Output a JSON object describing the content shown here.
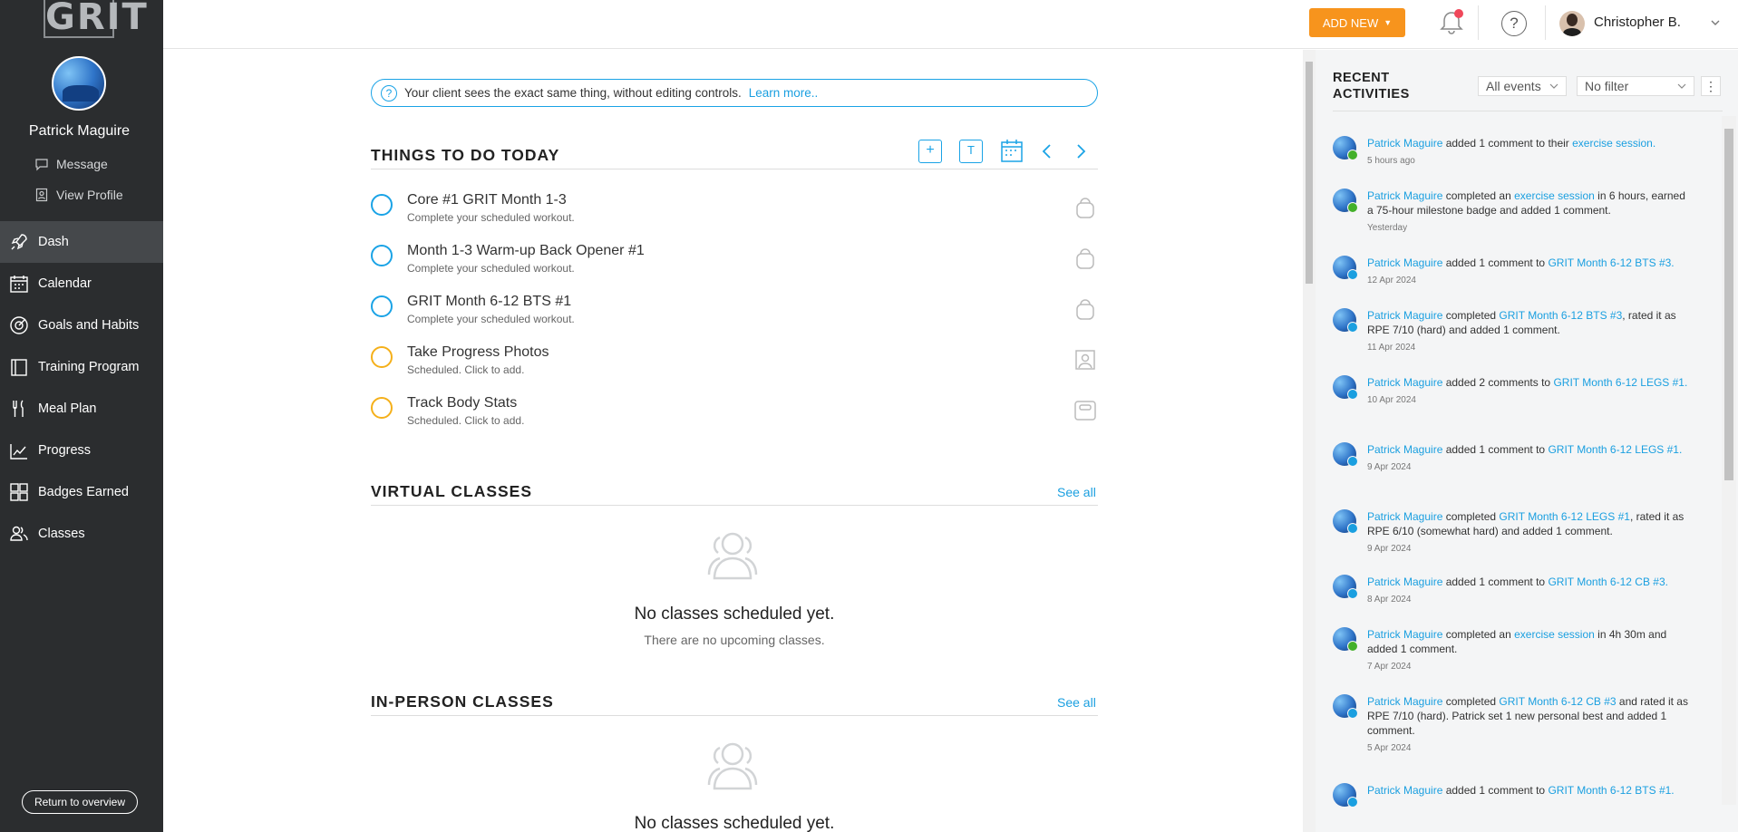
{
  "app": {
    "logo_text": "GRIT"
  },
  "sidebar": {
    "profile_name": "Patrick Maguire",
    "message_label": "Message",
    "view_profile_label": "View Profile",
    "items": [
      {
        "label": "Dash",
        "icon": "rocket-icon",
        "active": true
      },
      {
        "label": "Calendar",
        "icon": "calendar-icon"
      },
      {
        "label": "Goals and Habits",
        "icon": "goals-icon"
      },
      {
        "label": "Training Program",
        "icon": "training-program-icon"
      },
      {
        "label": "Meal Plan",
        "icon": "fork-knife-icon"
      },
      {
        "label": "Progress",
        "icon": "progress-chart-icon"
      },
      {
        "label": "Badges Earned",
        "icon": "badges-grid-icon"
      },
      {
        "label": "Classes",
        "icon": "classes-icon"
      }
    ],
    "return_label": "Return to overview"
  },
  "topbar": {
    "add_new_label": "ADD NEW",
    "user_name": "Christopher B.",
    "notification_dot_color": "#f0475a",
    "help_symbol": "?"
  },
  "banner": {
    "text": "Your client sees the exact same thing, without editing controls.",
    "link": "Learn more.."
  },
  "todo": {
    "title": "THINGS TO DO TODAY",
    "tasks": [
      {
        "title": "Core #1 GRIT Month 1-3",
        "sub": "Complete your scheduled workout.",
        "status": "blue",
        "icon": "kettlebell-icon"
      },
      {
        "title": "Month 1-3 Warm-up Back Opener #1",
        "sub": "Complete your scheduled workout.",
        "status": "blue",
        "icon": "kettlebell-icon"
      },
      {
        "title": "GRIT Month 6-12 BTS #1",
        "sub": "Complete your scheduled workout.",
        "status": "blue",
        "icon": "kettlebell-icon"
      },
      {
        "title": "Take Progress Photos",
        "sub": "Scheduled. Click to add.",
        "status": "orange",
        "icon": "photo-icon"
      },
      {
        "title": "Track Body Stats",
        "sub": "Scheduled. Click to add.",
        "status": "orange",
        "icon": "scale-icon"
      }
    ]
  },
  "virtual_classes": {
    "title": "VIRTUAL CLASSES",
    "see_all": "See all",
    "empty_title": "No classes scheduled yet.",
    "empty_sub": "There are no upcoming classes."
  },
  "inperson_classes": {
    "title": "IN-PERSON CLASSES",
    "see_all": "See all",
    "empty_title": "No classes scheduled yet."
  },
  "recent": {
    "title_line1": "RECENT",
    "title_line2": "ACTIVITIES",
    "filter_events": "All events",
    "filter_other": "No filter",
    "activities": [
      {
        "parts": [
          [
            "link",
            "Patrick Maguire"
          ],
          [
            "text",
            " added 1 comment to their "
          ],
          [
            "link",
            "exercise session."
          ]
        ],
        "date": "5 hours ago",
        "badge": "#43b02a"
      },
      {
        "parts": [
          [
            "link",
            "Patrick Maguire"
          ],
          [
            "text",
            " completed an "
          ],
          [
            "link",
            "exercise session"
          ],
          [
            "text",
            " in 6 hours, earned a 75-hour milestone badge and added 1 comment."
          ]
        ],
        "date": "Yesterday",
        "badge": "#43b02a"
      },
      {
        "parts": [
          [
            "link",
            "Patrick Maguire"
          ],
          [
            "text",
            " added 1 comment to "
          ],
          [
            "link",
            "GRIT Month 6-12 BTS #3."
          ]
        ],
        "date": "12 Apr 2024",
        "badge": "#1a9fe0"
      },
      {
        "parts": [
          [
            "link",
            "Patrick Maguire"
          ],
          [
            "text",
            " completed "
          ],
          [
            "link",
            "GRIT Month 6-12 BTS #3"
          ],
          [
            "text",
            ", rated it as RPE 7/10 (hard) and added 1 comment."
          ]
        ],
        "date": "11 Apr 2024",
        "badge": "#1a9fe0"
      },
      {
        "parts": [
          [
            "link",
            "Patrick Maguire"
          ],
          [
            "text",
            " added 2 comments to "
          ],
          [
            "link",
            "GRIT Month 6-12 LEGS #1."
          ]
        ],
        "date": "10 Apr 2024",
        "badge": "#1a9fe0"
      },
      {
        "parts": [
          [
            "link",
            "Patrick Maguire"
          ],
          [
            "text",
            " added 1 comment to "
          ],
          [
            "link",
            "GRIT Month 6-12 LEGS #1."
          ]
        ],
        "date": "9 Apr 2024",
        "badge": "#1a9fe0"
      },
      {
        "parts": [
          [
            "link",
            "Patrick Maguire"
          ],
          [
            "text",
            " completed "
          ],
          [
            "link",
            "GRIT Month 6-12 LEGS #1"
          ],
          [
            "text",
            ", rated it as RPE 6/10 (somewhat hard) and added 1 comment."
          ]
        ],
        "date": "9 Apr 2024",
        "badge": "#1a9fe0"
      },
      {
        "parts": [
          [
            "link",
            "Patrick Maguire"
          ],
          [
            "text",
            " added 1 comment to "
          ],
          [
            "link",
            "GRIT Month 6-12 CB #3."
          ]
        ],
        "date": "8 Apr 2024",
        "badge": "#1a9fe0"
      },
      {
        "parts": [
          [
            "link",
            "Patrick Maguire"
          ],
          [
            "text",
            " completed an "
          ],
          [
            "link",
            "exercise session"
          ],
          [
            "text",
            " in 4h 30m and added 1 comment."
          ]
        ],
        "date": "7 Apr 2024",
        "badge": "#43b02a"
      },
      {
        "parts": [
          [
            "link",
            "Patrick Maguire"
          ],
          [
            "text",
            " completed "
          ],
          [
            "link",
            "GRIT Month 6-12 CB #3"
          ],
          [
            "text",
            " and rated it as RPE 7/10 (hard). Patrick set 1 new personal best and added 1 comment."
          ]
        ],
        "date": "5 Apr 2024",
        "badge": "#1a9fe0"
      },
      {
        "parts": [
          [
            "link",
            "Patrick Maguire"
          ],
          [
            "text",
            " added 1 comment to "
          ],
          [
            "link",
            "GRIT Month 6-12 BTS #1."
          ]
        ],
        "date": "",
        "badge": "#1a9fe0"
      }
    ]
  }
}
